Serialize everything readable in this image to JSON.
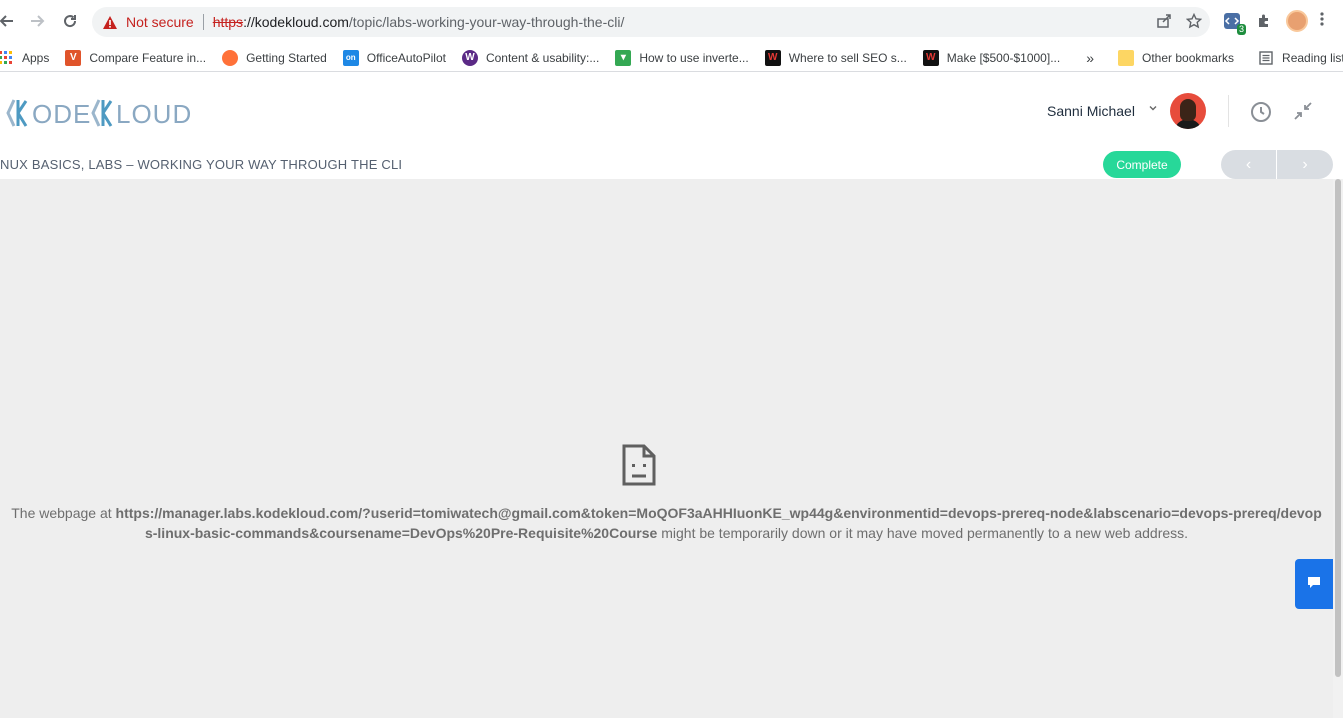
{
  "browser": {
    "address": {
      "not_secure_label": "Not secure",
      "scheme": "https",
      "host": "://kodekloud.com",
      "path": "/topic/labs-working-your-way-through-the-cli/"
    },
    "extension_badge": "3"
  },
  "bookmarks": [
    {
      "label": "Apps",
      "icon": "apps-grid-icon",
      "color": "#4285f4"
    },
    {
      "label": "Compare Feature in...",
      "icon": "v-icon",
      "color": "#e0542b"
    },
    {
      "label": "Getting Started",
      "icon": "firefox-icon",
      "color": "#ff7139"
    },
    {
      "label": "OfficeAutoPilot",
      "icon": "on-icon",
      "color": "#1e88e5"
    },
    {
      "label": "Content & usability:...",
      "icon": "w-icon",
      "color": "#5b2a86"
    },
    {
      "label": "How to use inverte...",
      "icon": "green-icon",
      "color": "#34a853"
    },
    {
      "label": "Where to sell SEO s...",
      "icon": "w-black-icon",
      "color": "#111111"
    },
    {
      "label": "Make [$500-$1000]...",
      "icon": "w-black-icon",
      "color": "#111111"
    }
  ],
  "bookmarks_overflow": "»",
  "other_bookmarks": "Other bookmarks",
  "reading_list": "Reading list",
  "site": {
    "logo_text": "KODEKLOUD",
    "user_name": "Sanni Michael",
    "breadcrumb": "NUX BASICS, LABS – WORKING YOUR WAY THROUGH THE CLI",
    "complete_label": "Complete",
    "prev_label": "‹",
    "next_label": "›"
  },
  "error": {
    "prefix": "The webpage at ",
    "url": "https://manager.labs.kodekloud.com/?userid=tomiwatech@gmail.com&token=MoQOF3aAHHIuonKE_wp44g&environmentid=devops-prereq-node&labscenario=devops-prereq/devops-linux-basic-commands&coursename=DevOps%20Pre-Requisite%20Course",
    "suffix": " might be temporarily down or it may have moved permanently to a new web address."
  },
  "colors": {
    "complete": "#27d899",
    "chat": "#1a73e8",
    "content_bg": "#eeeeee"
  }
}
